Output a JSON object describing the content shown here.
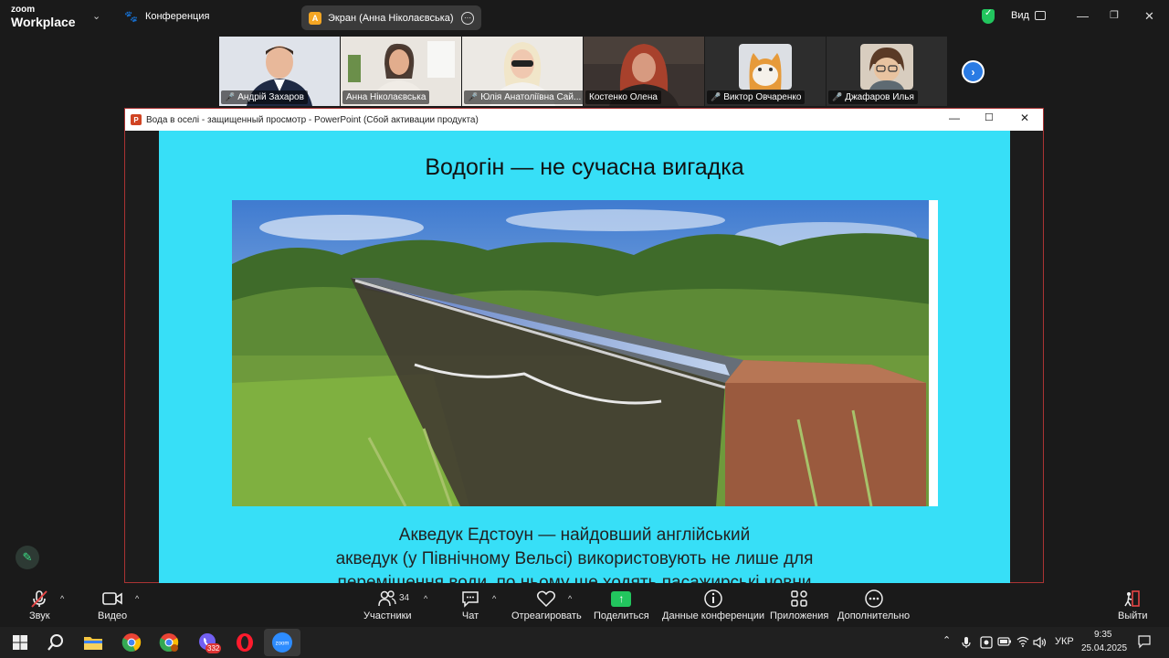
{
  "app": {
    "brand_line1": "zoom",
    "brand_line2": "Workplace",
    "meeting_label": "Конференция",
    "share_pill": {
      "initial": "A",
      "label": "Экран (Анна Ніколаєвська)"
    },
    "view_label": "Вид"
  },
  "participants": [
    {
      "name": "Андрій Захаров",
      "muted": true,
      "active": false
    },
    {
      "name": "Анна Ніколаєвська",
      "muted": false,
      "active": false
    },
    {
      "name": "Юлія Анатоліївна Сай...",
      "muted": true,
      "active": false
    },
    {
      "name": "Костенко Олена",
      "muted": false,
      "active": true
    },
    {
      "name": "Виктор Овчаренко",
      "muted": true,
      "active": false
    },
    {
      "name": "Джафаров Илья",
      "muted": true,
      "active": false
    }
  ],
  "ppt": {
    "window_title": "Вода в оселі  -  защищенный просмотр - PowerPoint (Сбой активации продукта)",
    "slide_title": "Водогін — не сучасна вигадка",
    "caption_line1": "Акведук Едстоун — найдовший англійський",
    "caption_line2": "акведук (у Північному Вельсі) використовують не лише для",
    "caption_line3": "переміщення води, по ньому ще ходять пасажирські човни"
  },
  "toolbar": {
    "audio": "Звук",
    "video": "Видео",
    "participants": "Участники",
    "participants_count": "34",
    "chat": "Чат",
    "react": "Отреагировать",
    "share": "Поделиться",
    "info": "Данные конференции",
    "apps": "Приложения",
    "more": "Дополнительно",
    "leave": "Выйти"
  },
  "taskbar": {
    "viber_badge": "332",
    "lang": "УКР",
    "time": "9:35",
    "date": "25.04.2025"
  },
  "colors": {
    "slide_bg": "#37dff7",
    "accent_green": "#22c55e",
    "active_outline": "#2ecc71",
    "mute_red": "#e64545",
    "zoom_blue": "#2a7be4"
  }
}
